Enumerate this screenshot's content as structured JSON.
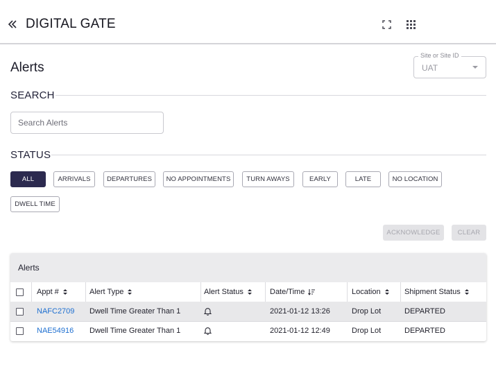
{
  "app": {
    "title": "DIGITAL GATE"
  },
  "page": {
    "title": "Alerts"
  },
  "site_field": {
    "label": "Site or Site ID",
    "value": "UAT"
  },
  "search": {
    "heading": "SEARCH",
    "placeholder": "Search Alerts"
  },
  "status": {
    "heading": "STATUS",
    "filters": [
      "ALL",
      "ARRIVALS",
      "DEPARTURES",
      "NO APPOINTMENTS",
      "TURN AWAYS",
      "EARLY",
      "LATE",
      "NO LOCATION",
      "DWELL TIME"
    ],
    "selected": "ALL"
  },
  "actions": {
    "acknowledge_label": "ACKNOWLEDGE",
    "clear_label": "CLEAR"
  },
  "table": {
    "title": "Alerts",
    "columns": [
      "Appt #",
      "Alert Type",
      "Alert Status",
      "Date/Time",
      "Location",
      "Shipment Status"
    ],
    "rows": [
      {
        "appt": "NAFC2709",
        "alert_type": "Dwell Time Greater Than 1",
        "alert_status_icon": "bell-icon",
        "datetime": "2021-01-12 13:26",
        "location": "Drop Lot",
        "shipment_status": "DEPARTED"
      },
      {
        "appt": "NAE54916",
        "alert_type": "Dwell Time Greater Than 1",
        "alert_status_icon": "bell-icon",
        "datetime": "2021-01-12 12:49",
        "location": "Drop Lot",
        "shipment_status": "DEPARTED"
      }
    ]
  },
  "colors": {
    "active_chip": "#2c2a4f",
    "link": "#1e6fd0",
    "header_bg": "#ebebed"
  }
}
